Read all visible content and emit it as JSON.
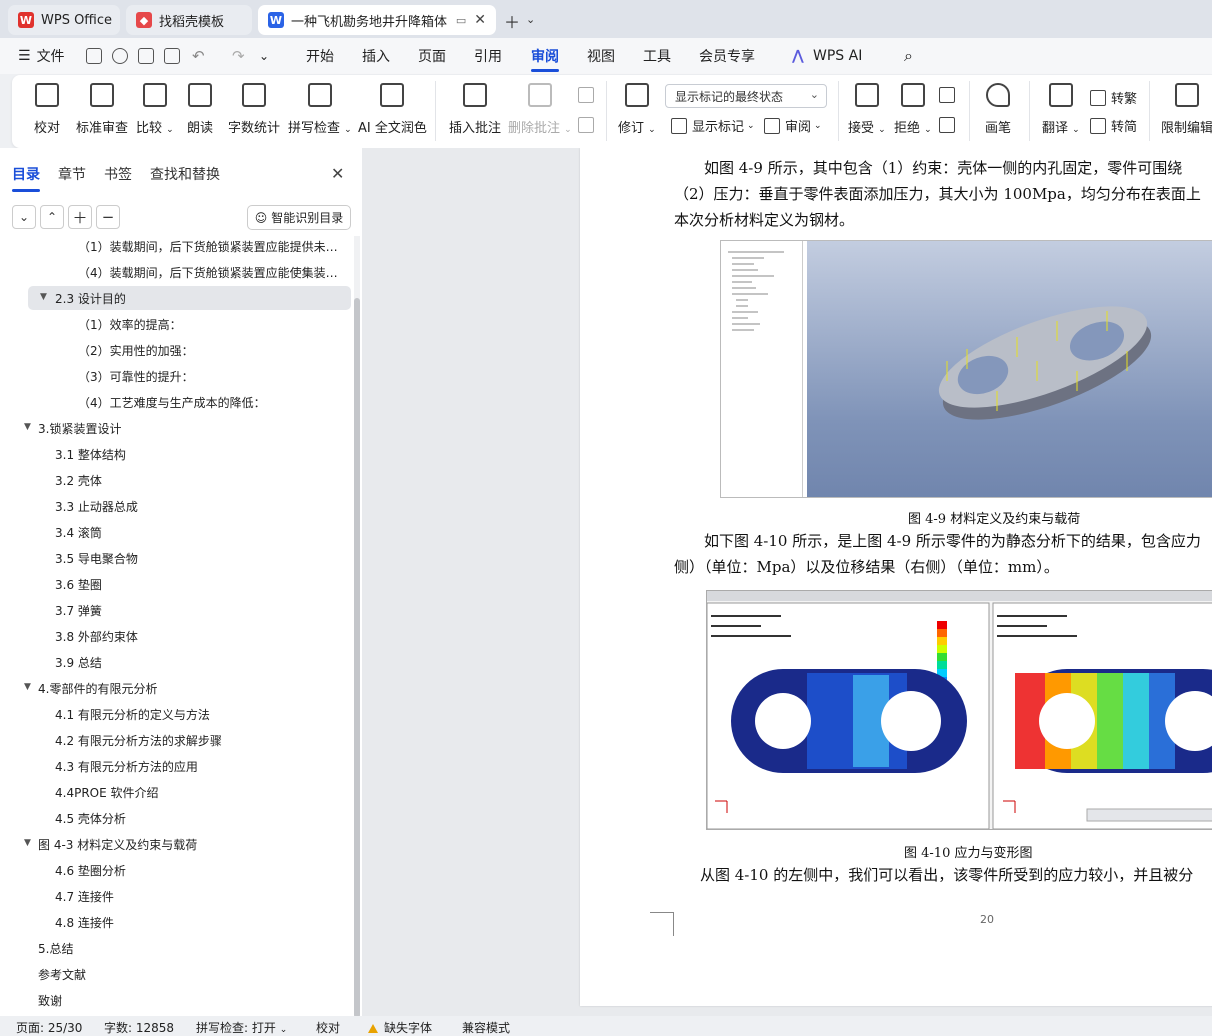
{
  "tabs": [
    {
      "label": "WPS Office",
      "icon": "wps-logo-icon"
    },
    {
      "label": "找稻壳模板",
      "icon": "docer-logo-icon"
    },
    {
      "label": "一种飞机勘务地井升降箱体限",
      "icon": "word-doc-icon"
    }
  ],
  "menu": {
    "file": "文件",
    "items": [
      "开始",
      "插入",
      "页面",
      "引用",
      "审阅",
      "视图",
      "工具",
      "会员专享",
      "WPS AI"
    ],
    "active": "审阅"
  },
  "ribbon": {
    "proofread": "校对",
    "standard_review": "标准审查",
    "compare": "比较",
    "read_aloud": "朗读",
    "word_count": "字数统计",
    "spell_check": "拼写检查",
    "ai_polish": "AI 全文润色",
    "insert_comment": "插入批注",
    "delete_comment": "删除批注",
    "track_changes": "修订",
    "show_markup_select": "显示标记的最终状态",
    "show_markup": "显示标记",
    "review": "审阅",
    "accept": "接受",
    "reject": "拒绝",
    "pen": "画笔",
    "translate": "翻译",
    "to_traditional": "转繁",
    "to_simplified": "转简",
    "restrict_edit": "限制编辑"
  },
  "sidebar": {
    "tabs": [
      "目录",
      "章节",
      "书签",
      "查找和替换"
    ],
    "active_tab": "目录",
    "smart_toc": "智能识别目录",
    "toc": [
      {
        "text": "（1）装载期间，后下货舱锁紧装置应能提供未满…",
        "level": 3
      },
      {
        "text": "（4）装载期间，后下货舱锁紧装置应能使集装器…",
        "level": 3
      },
      {
        "text": "2.3 设计目的",
        "level": 2,
        "expanded": true,
        "selected": true
      },
      {
        "text": "（1）效率的提高：",
        "level": 3
      },
      {
        "text": "（2）实用性的加强：",
        "level": 3
      },
      {
        "text": "（3）可靠性的提升：",
        "level": 3
      },
      {
        "text": "（4）工艺难度与生产成本的降低：",
        "level": 3
      },
      {
        "text": "3.锁紧装置设计",
        "level": 1,
        "expanded": true
      },
      {
        "text": "3.1 整体结构",
        "level": 2
      },
      {
        "text": "3.2 壳体",
        "level": 2
      },
      {
        "text": "3.3 止动器总成",
        "level": 2
      },
      {
        "text": "3.4 滚筒",
        "level": 2
      },
      {
        "text": "3.5 导电聚合物",
        "level": 2
      },
      {
        "text": "3.6 垫圈",
        "level": 2
      },
      {
        "text": "3.7 弹簧",
        "level": 2
      },
      {
        "text": "3.8 外部约束体",
        "level": 2
      },
      {
        "text": "3.9 总结",
        "level": 2
      },
      {
        "text": "4.零部件的有限元分析",
        "level": 1,
        "expanded": true
      },
      {
        "text": "4.1 有限元分析的定义与方法",
        "level": 2
      },
      {
        "text": "4.2 有限元分析方法的求解步骤",
        "level": 2
      },
      {
        "text": "4.3 有限元分析方法的应用",
        "level": 2
      },
      {
        "text": "4.4PROE 软件介绍",
        "level": 2
      },
      {
        "text": "4.5 壳体分析",
        "level": 2
      },
      {
        "text": "图 4-3 材料定义及约束与载荷",
        "level": 1,
        "expanded": true
      },
      {
        "text": "4.6 垫圈分析",
        "level": 2
      },
      {
        "text": "4.7 连接件",
        "level": 2
      },
      {
        "text": "4.8 连接件",
        "level": 2
      },
      {
        "text": "5.总结",
        "level": 1
      },
      {
        "text": "参考文献",
        "level": 1
      },
      {
        "text": "致谢",
        "level": 1
      }
    ]
  },
  "document": {
    "para1": [
      "如图 4-9 所示，其中包含（1）约束：壳体一侧的内孔固定，零件可围绕",
      "（2）压力：垂直于零件表面添加压力，其大小为 100Mpa，均匀分布在表面上",
      "本次分析材料定义为钢材。"
    ],
    "caption1": "图 4-9 材料定义及约束与载荷",
    "para2": [
      "如下图 4-10 所示，是上图 4-9 所示零件的为静态分析下的结果，包含应力",
      "侧）（单位：Mpa）以及位移结果（右侧）（单位：mm）。"
    ],
    "caption2": "图 4-10 应力与变形图",
    "para3": "从图 4-10 的左侧中，我们可以看出，该零件所受到的应力较小，并且被分",
    "page_number": "20"
  },
  "status": {
    "page": "页面: 25/30",
    "words": "字数: 12858",
    "spell": "拼写检查: 打开",
    "proof": "校对",
    "missing_font": "缺失字体",
    "compat": "兼容模式"
  },
  "colors": {
    "accent": "#1a4ed9",
    "wps_red": "#e0322d",
    "docer_red": "#e6484a",
    "doc_blue": "#2b63e6"
  }
}
